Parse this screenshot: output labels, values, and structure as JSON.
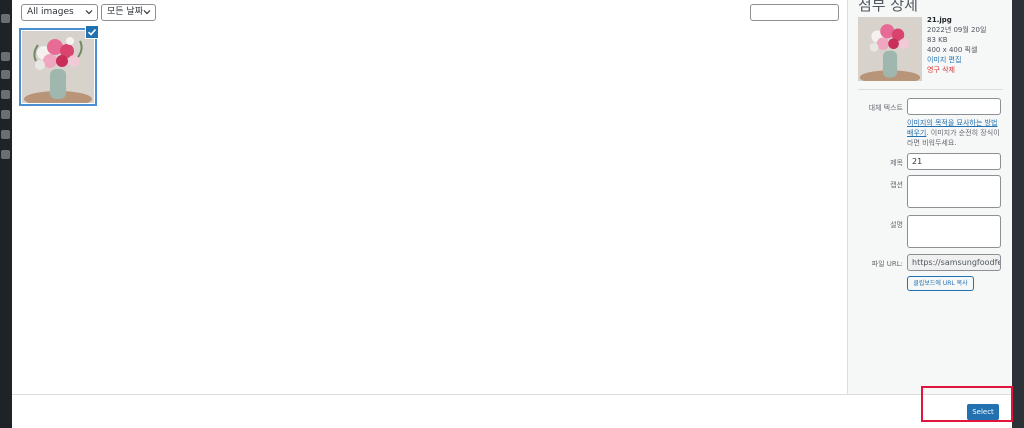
{
  "toolbar": {
    "filter_type": "All images",
    "filter_date": "모든 날짜",
    "search_placeholder": ""
  },
  "attachments": [
    {
      "filename": "21.jpg",
      "selected": true
    }
  ],
  "details": {
    "title": "첨부 상세",
    "filename": "21.jpg",
    "date": "2022년 09월 20일",
    "size": "83 KB",
    "dimensions": "400 x 400 픽셀",
    "edit_link": "이미지 편집",
    "delete_link": "영구 삭제"
  },
  "form": {
    "alt_label": "대체 텍스트",
    "alt_value": "",
    "alt_help_link": "이미지의 목적을 묘사하는 방법 배우기",
    "alt_help_text": ". 이미지가 순전히 장식이라면 비워두세요.",
    "title_label": "제목",
    "title_value": "21",
    "caption_label": "캡션",
    "caption_value": "",
    "description_label": "설명",
    "description_value": "",
    "url_label": "파일 URL:",
    "url_value": "https://samsungfoodfesta.c",
    "copy_button": "클립보드에 URL 복사"
  },
  "footer": {
    "select_button": "Select"
  },
  "colors": {
    "accent": "#2271b1",
    "highlight": "#e0143c",
    "danger": "#d63638"
  }
}
